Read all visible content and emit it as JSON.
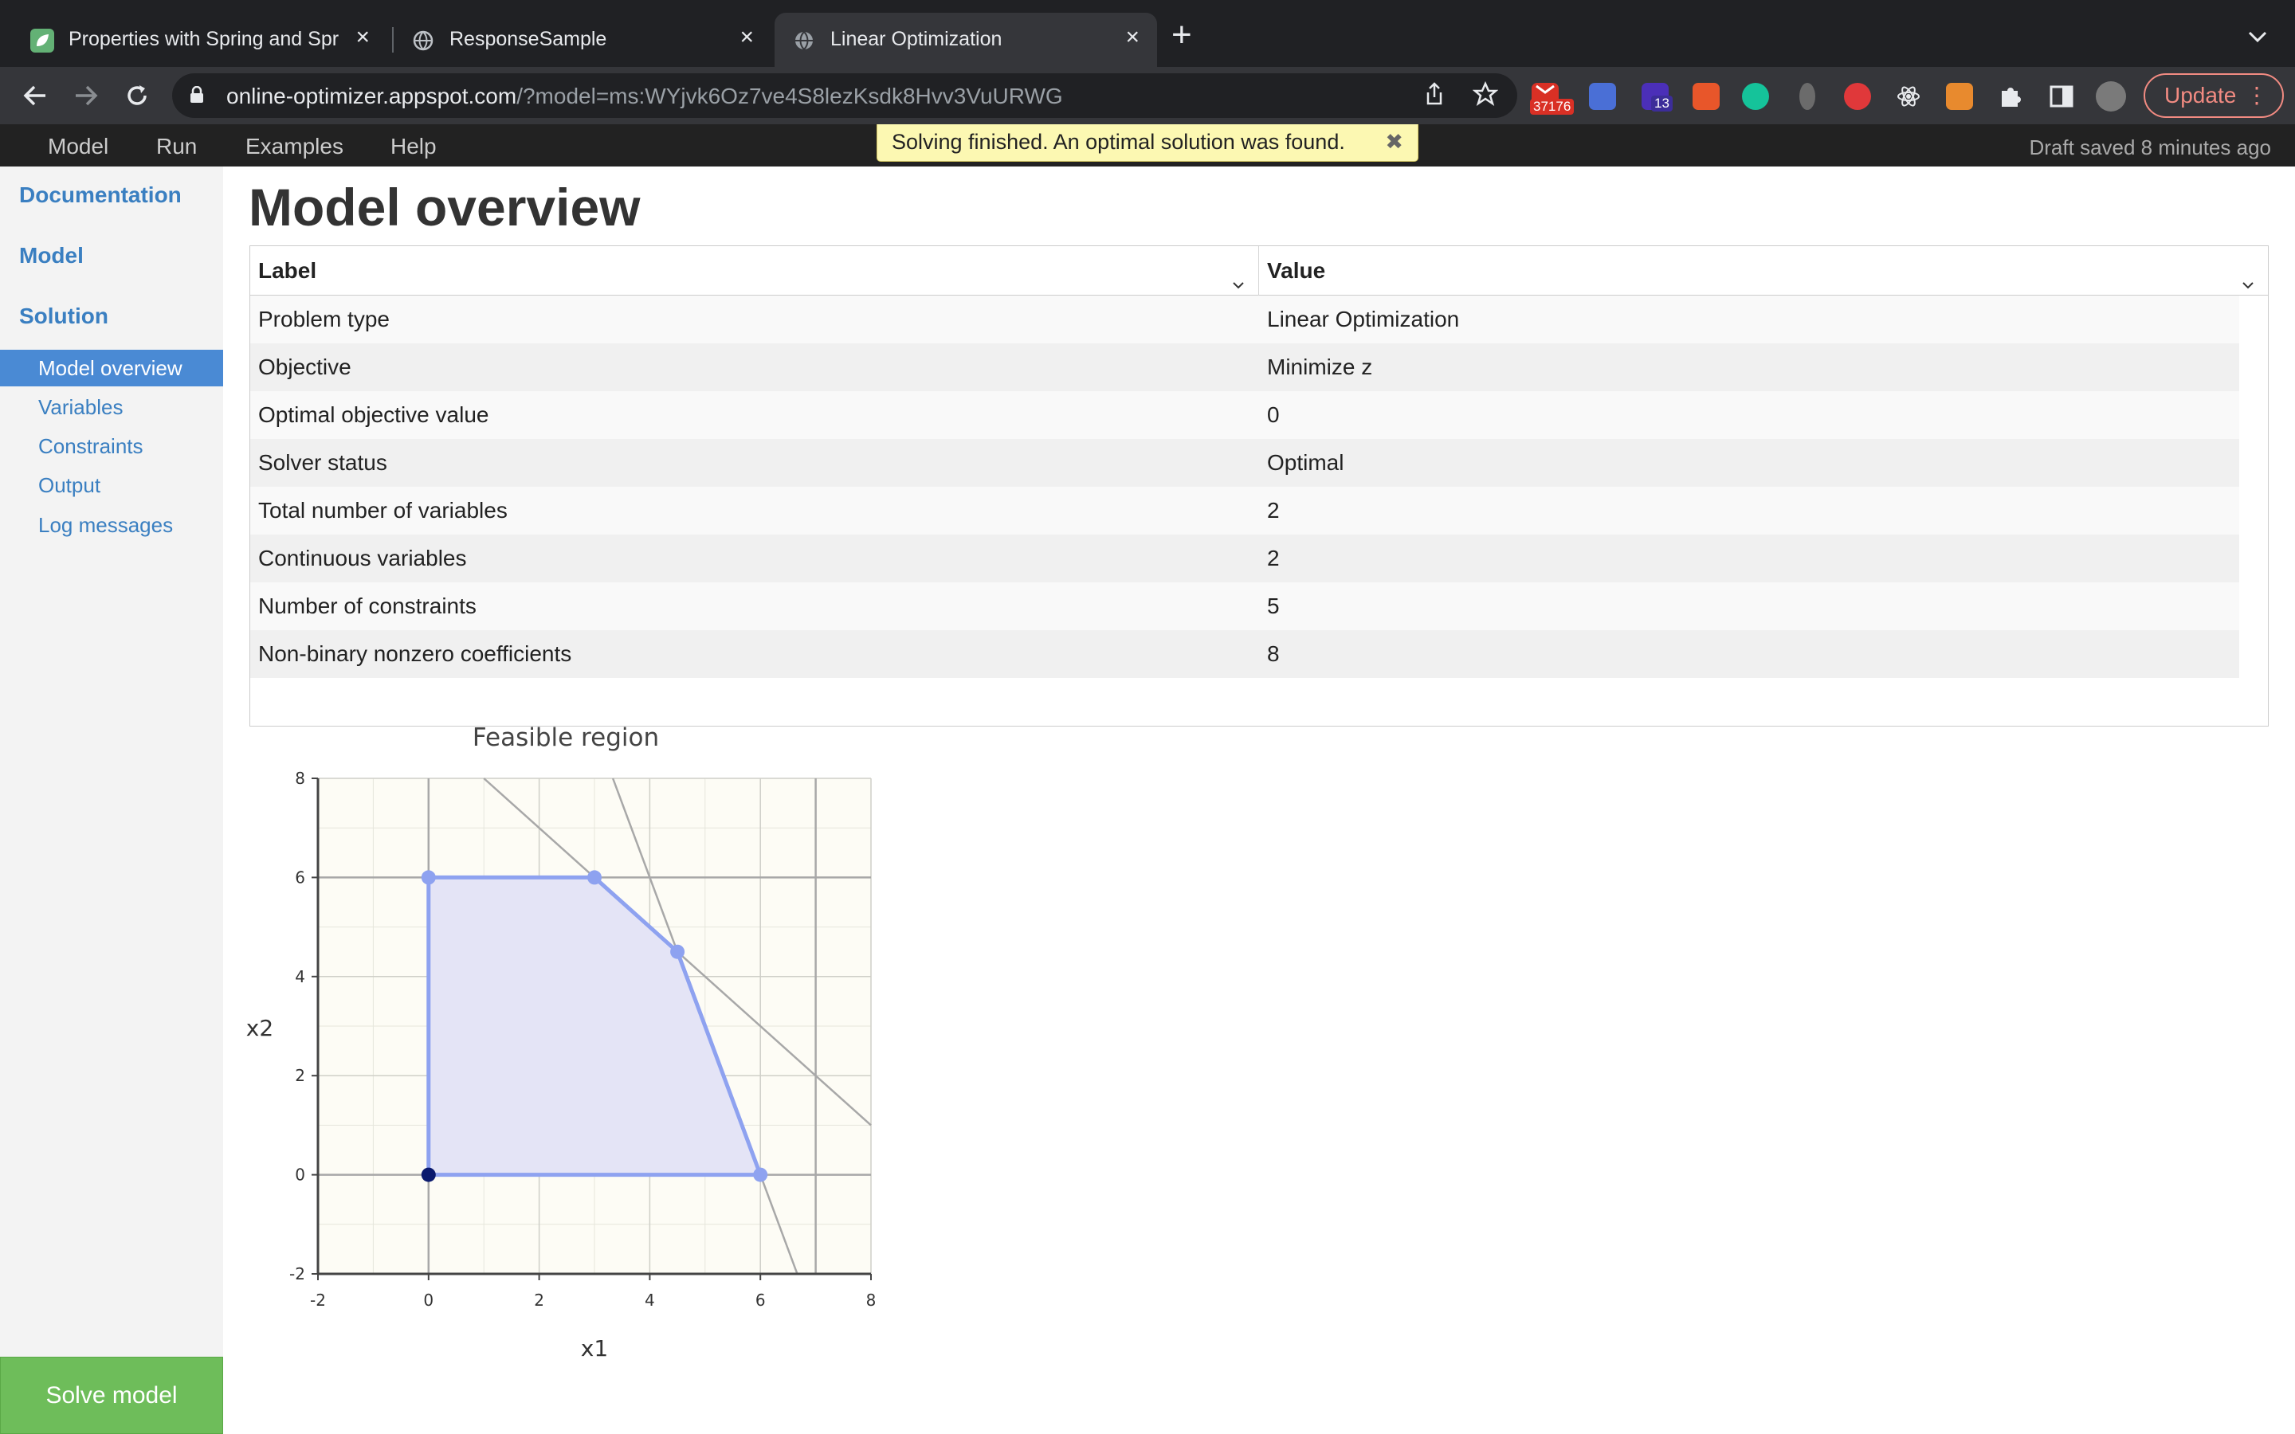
{
  "browser": {
    "tabs": [
      {
        "title": "Properties with Spring and Spring Boot | Baeldung",
        "favicon": "leaf-icon",
        "active": false
      },
      {
        "title": "ResponseSample",
        "favicon": "globe-icon",
        "active": false
      },
      {
        "title": "Linear Optimization",
        "favicon": "globe-icon",
        "active": true
      }
    ],
    "url_host": "online-optimizer.appspot.com",
    "url_path": "/?model=ms:WYjvk6Oz7ve4S8lezKsdk8Hvv3VuURWG",
    "extension_badges": {
      "mail": "37176",
      "ext": "13"
    },
    "update_label": "Update"
  },
  "appbar": {
    "menus": [
      "Model",
      "Run",
      "Examples",
      "Help"
    ],
    "notice": "Solving finished. An optimal solution was found.",
    "notice_close": "✖",
    "draft_status": "Draft saved 8 minutes ago"
  },
  "sidebar": {
    "headings": [
      "Documentation",
      "Model",
      "Solution"
    ],
    "items": [
      {
        "label": "Model overview",
        "active": true
      },
      {
        "label": "Variables",
        "active": false
      },
      {
        "label": "Constraints",
        "active": false
      },
      {
        "label": "Output",
        "active": false
      },
      {
        "label": "Log messages",
        "active": false
      }
    ],
    "solve_button": "Solve model"
  },
  "main": {
    "title": "Model overview",
    "table": {
      "columns": [
        "Label",
        "Value"
      ],
      "rows": [
        [
          "Problem type",
          "Linear Optimization"
        ],
        [
          "Objective",
          "Minimize z"
        ],
        [
          "Optimal objective value",
          "0"
        ],
        [
          "Solver status",
          "Optimal"
        ],
        [
          "Total number of variables",
          "2"
        ],
        [
          "Continuous variables",
          "2"
        ],
        [
          "Number of constraints",
          "5"
        ],
        [
          "Non-binary nonzero coefficients",
          "8"
        ]
      ]
    }
  },
  "chart_data": {
    "type": "scatter",
    "title": "Feasible region",
    "xlabel": "x1",
    "ylabel": "x2",
    "xlim": [
      -2,
      8
    ],
    "ylim": [
      -2,
      8
    ],
    "xticks": [
      -2,
      0,
      2,
      4,
      6,
      8
    ],
    "yticks": [
      -2,
      0,
      2,
      4,
      6,
      8
    ],
    "grid": true,
    "feasible_region": [
      [
        0,
        0
      ],
      [
        0,
        6
      ],
      [
        3,
        6
      ],
      [
        4.5,
        4.5
      ],
      [
        6,
        0
      ]
    ],
    "optimal_point": [
      0,
      0
    ],
    "constraint_lines": [
      {
        "kind": "vertical",
        "x": 0
      },
      {
        "kind": "horizontal",
        "y": 0
      },
      {
        "kind": "horizontal",
        "y": 6
      },
      {
        "kind": "vertical",
        "x": 7
      },
      {
        "kind": "line",
        "from": [
          1,
          8
        ],
        "to": [
          8,
          1
        ]
      },
      {
        "kind": "line",
        "from": [
          3.333,
          8
        ],
        "to": [
          6.667,
          -2
        ]
      }
    ],
    "colors": {
      "region_fill": "#e4e4f6",
      "region_stroke": "#8ea2f0",
      "optimal": "#0b1a6e",
      "plot_bg": "#fdfcf5",
      "constraint": "#a8a8a8"
    }
  }
}
